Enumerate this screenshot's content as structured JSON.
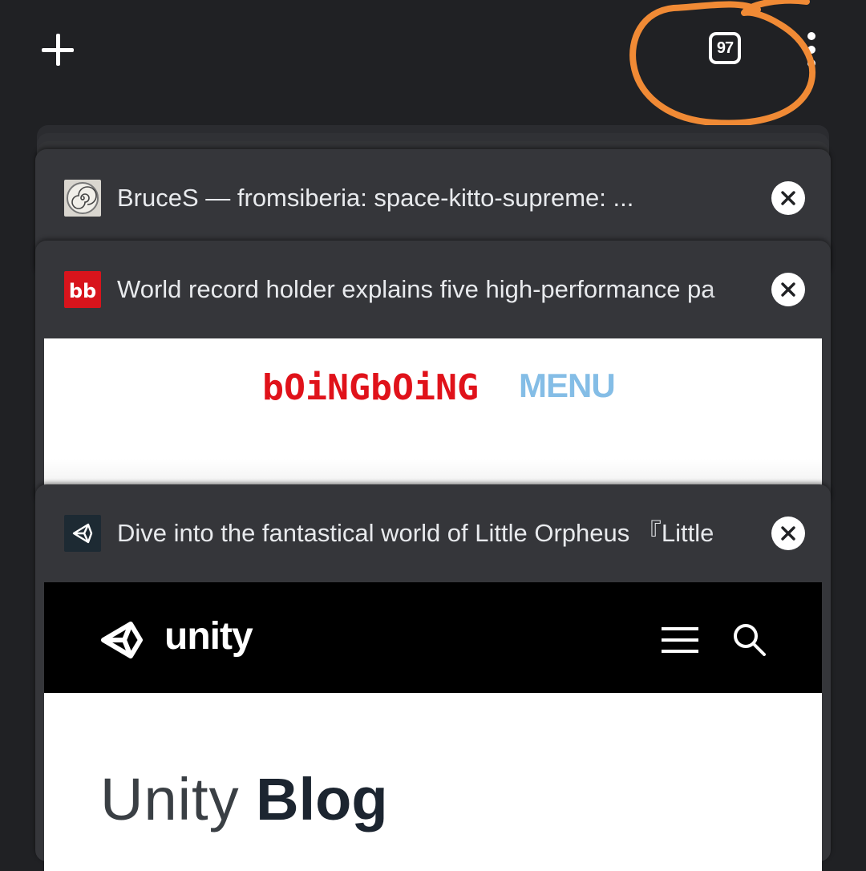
{
  "toolbar": {
    "tab_count": "97",
    "new_tab_icon": "plus-icon",
    "menu_icon": "more-vert-icon"
  },
  "annotation": {
    "color": "#f08a35",
    "shape": "freehand circle around tab count"
  },
  "tabs": [
    {
      "title": "BruceS — fromsiberia: space-kitto-supreme: ...",
      "favicon": "spiral-clock-icon",
      "close_icon": "close-icon"
    },
    {
      "title": "World record holder explains five high-performance pa",
      "favicon": "boingboing-bb-icon",
      "close_icon": "close-icon",
      "preview": {
        "logo_text": "bOiNGbOiNG",
        "menu_label": "MENU"
      }
    },
    {
      "title": "Dive into the fantastical world of Little Orpheus 『Little",
      "favicon": "unity-icon",
      "close_icon": "close-icon",
      "preview": {
        "brand": "unity",
        "heading_light": "Unity",
        "heading_bold": "Blog"
      }
    }
  ],
  "colors": {
    "background": "#202124",
    "card": "#35363a",
    "boingboing_red": "#e0121a",
    "menu_blue": "#84bde6"
  }
}
